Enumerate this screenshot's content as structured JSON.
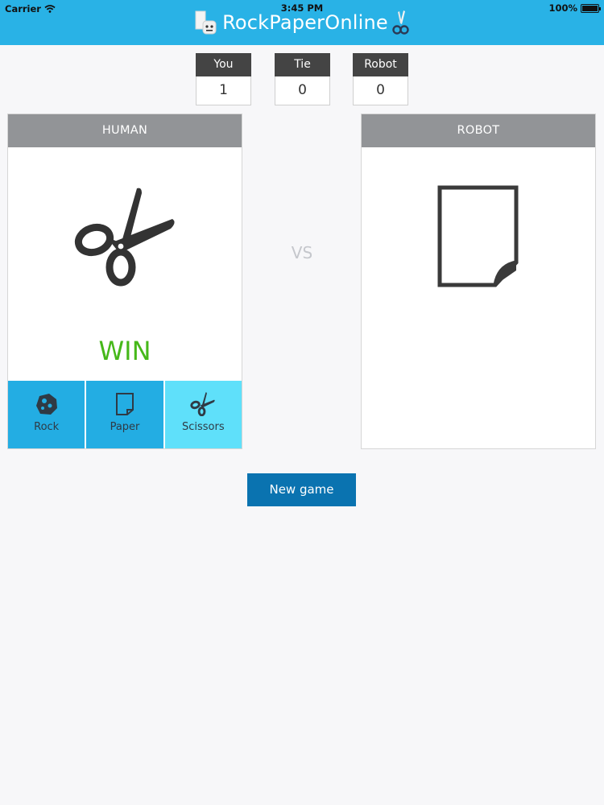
{
  "status_bar": {
    "carrier": "Carrier",
    "time": "3:45 PM",
    "battery": "100%"
  },
  "app": {
    "title": "RockPaperOnline",
    "accent": "#29b2e6"
  },
  "scores": [
    {
      "label": "You",
      "value": "1"
    },
    {
      "label": "Tie",
      "value": "0"
    },
    {
      "label": "Robot",
      "value": "0"
    }
  ],
  "human": {
    "title": "HUMAN",
    "selected_icon": "scissors-icon",
    "result": "WIN",
    "result_color": "#46b81a",
    "choices": [
      {
        "label": "Rock",
        "icon": "rock-icon",
        "active": false
      },
      {
        "label": "Paper",
        "icon": "paper-icon",
        "active": false
      },
      {
        "label": "Scissors",
        "icon": "scissors-icon",
        "active": true
      }
    ]
  },
  "vs_label": "VS",
  "robot": {
    "title": "ROBOT",
    "selected_icon": "paper-icon"
  },
  "new_game_label": "New game"
}
